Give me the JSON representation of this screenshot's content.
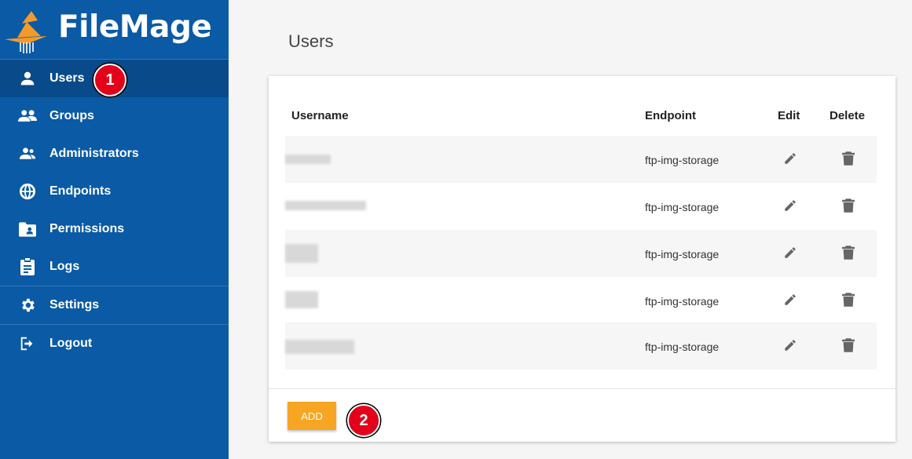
{
  "brand": {
    "name": "FileMage"
  },
  "sidebar": {
    "items": [
      {
        "label": "Users",
        "icon": "user-icon",
        "active": true
      },
      {
        "label": "Groups",
        "icon": "group-icon"
      },
      {
        "label": "Administrators",
        "icon": "admins-icon"
      },
      {
        "label": "Endpoints",
        "icon": "globe-icon"
      },
      {
        "label": "Permissions",
        "icon": "folder-user-icon"
      },
      {
        "label": "Logs",
        "icon": "clipboard-icon"
      },
      {
        "label": "Settings",
        "icon": "gear-icon"
      },
      {
        "label": "Logout",
        "icon": "logout-icon"
      }
    ]
  },
  "main": {
    "title": "Users",
    "table": {
      "headers": [
        "Username",
        "Endpoint",
        "Edit",
        "Delete"
      ],
      "rows": [
        {
          "username": "",
          "endpoint": "ftp-img-storage"
        },
        {
          "username": "",
          "endpoint": "ftp-img-storage"
        },
        {
          "username": "",
          "endpoint": "ftp-img-storage"
        },
        {
          "username": "",
          "endpoint": "ftp-img-storage"
        },
        {
          "username": "",
          "endpoint": "ftp-img-storage"
        }
      ]
    },
    "add_label": "ADD"
  },
  "annotations": {
    "step1": "1",
    "step2": "2"
  },
  "colors": {
    "sidebar": "#0a5aa5",
    "active": "#084a8a",
    "accent": "#f6a623",
    "badge": "#e3001b"
  }
}
